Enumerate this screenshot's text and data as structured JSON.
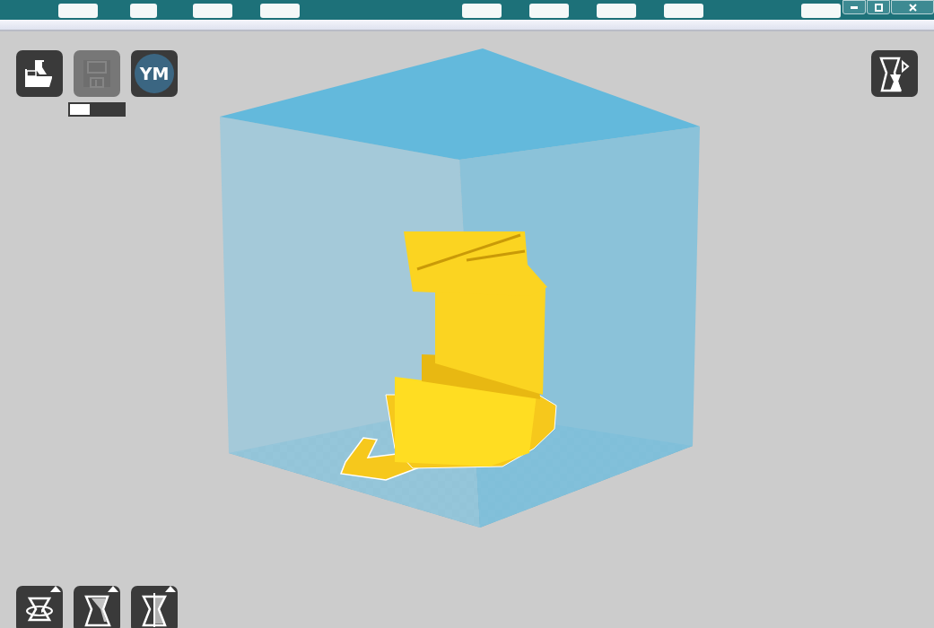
{
  "toolbar": {
    "buttons": [
      {
        "kind": "load",
        "disabled": false
      },
      {
        "kind": "save",
        "disabled": true
      },
      {
        "kind": "account",
        "label": "YM",
        "disabled": false
      }
    ],
    "progress": {
      "level": 0.37
    }
  },
  "tool_buttons": [
    {
      "kind": "rotate"
    },
    {
      "kind": "scale"
    },
    {
      "kind": "mirror"
    }
  ]
}
